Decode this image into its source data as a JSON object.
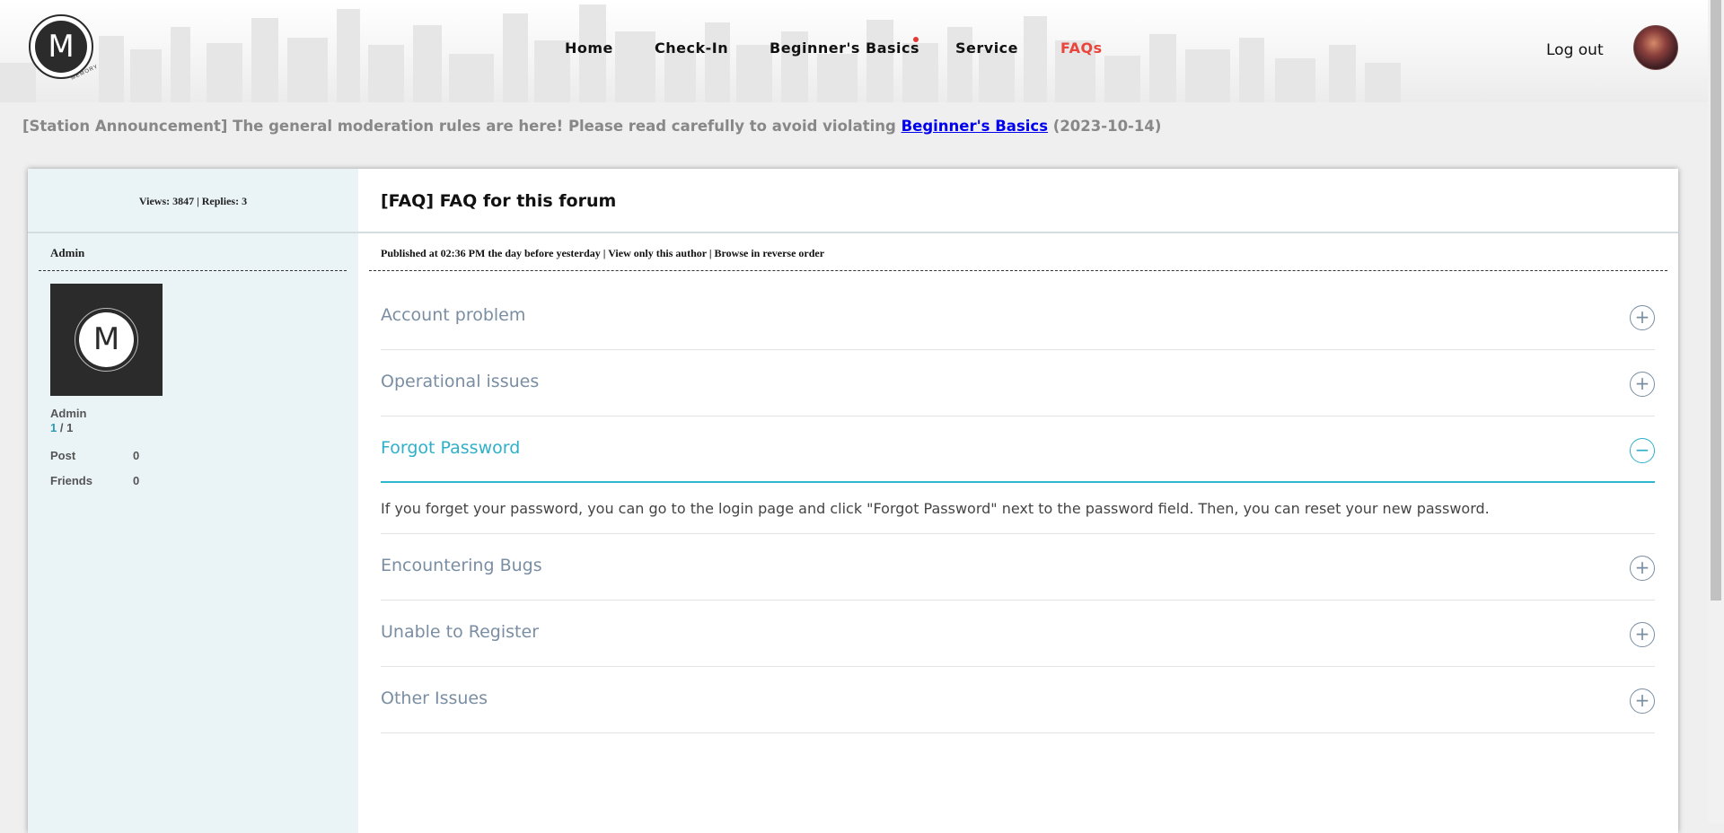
{
  "header": {
    "logo_letter": "M",
    "logo_subtext": "MEMORY",
    "nav": [
      {
        "label": "Home"
      },
      {
        "label": "Check-In"
      },
      {
        "label": "Beginner's Basics"
      },
      {
        "label": "Service"
      },
      {
        "label": "FAQs",
        "active": true
      }
    ],
    "logout_label": "Log out"
  },
  "announcement": {
    "prefix": "[Station Announcement] The general moderation rules are here! Please read carefully to avoid violating",
    "link_text": "Beginner's Basics",
    "date": "(2023-10-14)"
  },
  "sidebar": {
    "stats_line": "Views: 3847 | Replies: 3",
    "author_heading": "Admin",
    "avatar_letter": "M",
    "username": "Admin",
    "level_current": "1",
    "level_sep": " / ",
    "level_total": "1",
    "post_label": "Post",
    "post_value": "0",
    "friends_label": "Friends",
    "friends_value": "0"
  },
  "post": {
    "title": "[FAQ] FAQ for this forum",
    "published": "Published at 02:36 PM the day before yesterday",
    "view_only_author": "View only this author",
    "browse_reverse": "Browse in reverse order",
    "separator": " | "
  },
  "faq": {
    "items": [
      {
        "question": "Account problem",
        "icon": "plus-circle-icon",
        "open": false
      },
      {
        "question": "Operational issues",
        "icon": "plus-circle-icon",
        "open": false
      },
      {
        "question": "Forgot Password",
        "icon": "minus-circle-icon",
        "open": true,
        "answer": "If you forget your password, you can go to the login page and click \"Forgot Password\" next to the password field. Then, you can reset your new password."
      },
      {
        "question": "Encountering Bugs",
        "icon": "plus-circle-icon",
        "open": false
      },
      {
        "question": "Unable to Register",
        "icon": "plus-circle-icon",
        "open": false
      },
      {
        "question": "Other Issues",
        "icon": "plus-circle-icon",
        "open": false
      }
    ],
    "plus_glyph": "+",
    "minus_glyph": "−"
  },
  "colors": {
    "accent": "#2eb0c8",
    "nav_active": "#e8453c",
    "notification_dot": "#e53935",
    "link": "#0000ee"
  }
}
